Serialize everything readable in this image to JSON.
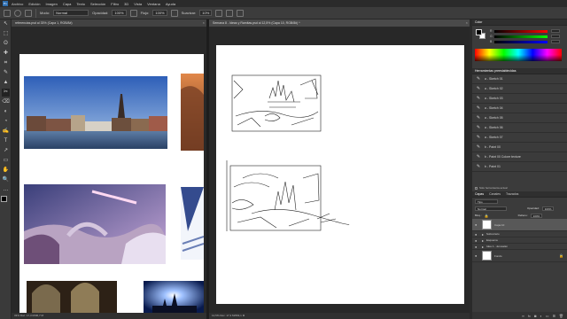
{
  "menubar": {
    "logo": "Ps",
    "items": [
      "Archivo",
      "Edición",
      "Imagen",
      "Capa",
      "Texto",
      "Selección",
      "Filtro",
      "3D",
      "Vista",
      "Ventana",
      "Ayuda"
    ]
  },
  "options": {
    "mode_label": "Modo:",
    "mode_value": "Normal",
    "opacity_label": "Opacidad:",
    "opacity_value": "100%",
    "flow_label": "Flujo:",
    "flow_value": "100%",
    "smoothing_label": "Suavizar:",
    "smoothing_value": "10%"
  },
  "tools": [
    "↖",
    "⬚",
    "ʘ",
    "✚",
    "⌗",
    "✎",
    "▲",
    "✂",
    "⌫",
    "◐",
    "◔",
    "✍",
    "T",
    "↗",
    "▭",
    "✋",
    "🔍",
    "…",
    "■"
  ],
  "doc_left": {
    "tab": "referencias.psd al 33% (Capa 1, RGB/8#)",
    "status": "33%    Doc: 17,3 M/96,7 M"
  },
  "doc_right": {
    "tab": "Semana 8 - Ideas y Ramitas.psd al 12,5% (Capa 10, RGB/8#) *",
    "status": "12,5%    Doc: 17,3 M/663,1 M"
  },
  "panels": {
    "color_tab": "Color",
    "presets_tab": "Herramientas preestablecidas",
    "presets": [
      "a - Sketch 01",
      "a - Sketch 02",
      "a - Sketch 03",
      "a - Sketch 04",
      "a - Sketch 05",
      "a - Sketch 06",
      "a - Sketch 07",
      "b - Paint 00",
      "b - Paint 00 Colore texture",
      "b - Paint 01"
    ],
    "only_current": "Sólo herramienta actual",
    "layers_tabs": [
      "Capas",
      "Canales",
      "Trazados"
    ],
    "search_kind": "Tipo",
    "blend_mode": "Normal",
    "opacity_label": "Opacidad:",
    "opacity_value": "100%",
    "lock_label": "Bloq.:",
    "fill_label": "Relleno:",
    "fill_value": "100%",
    "layers": [
      {
        "name": "Capa 10",
        "active": true
      },
      {
        "name": "Sobretrazo",
        "active": false
      },
      {
        "name": "Esquema",
        "active": false
      },
      {
        "name": "Idea 1 - Jerusalén",
        "active": false
      },
      {
        "name": "Fondo",
        "active": false
      }
    ]
  },
  "colors": {
    "accent": "#2f6fb0",
    "panel_bg": "#3b3b3b",
    "menubar_bg": "#2b2b2b",
    "canvas": "#ffffff"
  }
}
